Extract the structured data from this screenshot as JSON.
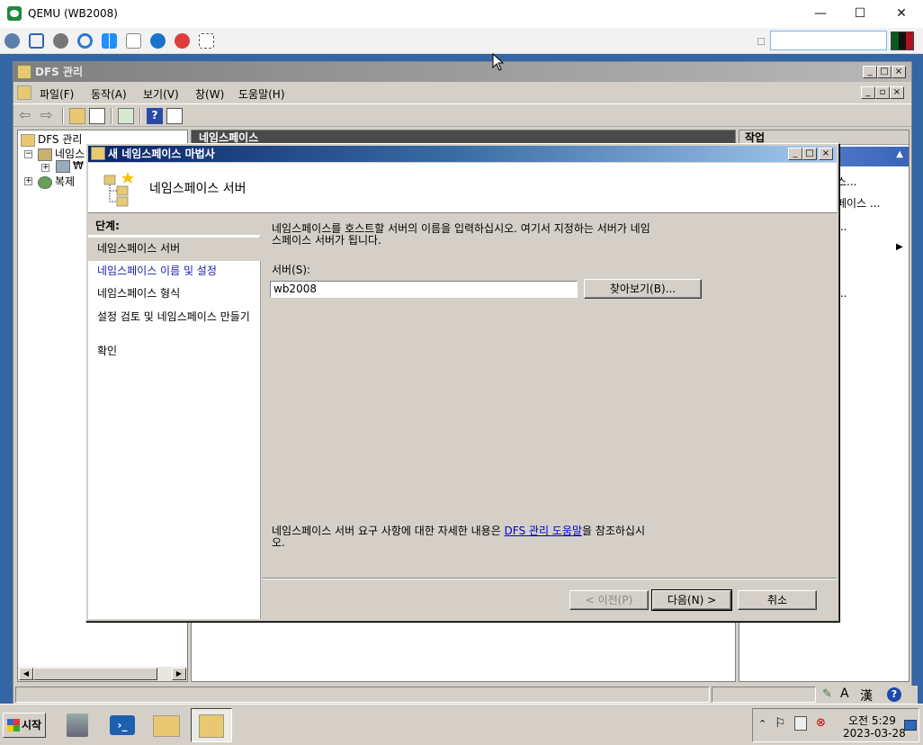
{
  "host": {
    "title": "QEMU (WB2008)",
    "minimize": "—",
    "maximize": "☐",
    "close": "✕"
  },
  "mmc": {
    "title": "DFS 관리",
    "menu": [
      "파일(F)",
      "동작(A)",
      "보기(V)",
      "창(W)",
      "도움말(H)"
    ],
    "tree": {
      "root": "DFS 관리",
      "namespaces": "네임스",
      "namespace_child": "₩",
      "replication": "복제"
    },
    "center_header": "네임스페이스",
    "actions": {
      "header": "작업",
      "items": [
        "스...",
        "페이스 ...",
        "...",
        "..."
      ]
    }
  },
  "wizard": {
    "title": "새 네임스페이스 마법사",
    "header_title": "네임스페이스 서버",
    "steps_label": "단계:",
    "steps": [
      "네임스페이스 서버",
      "네임스페이스 이름 및 설정",
      "네임스페이스 형식",
      "설정 검토 및 네임스페이스 만들기",
      "확인"
    ],
    "description_line1": "네임스페이스를 호스트할 서버의 이름을 입력하십시오. 여기서 지정하는 서버가 네임",
    "description_line2": "스페이스 서버가 됩니다.",
    "server_label": "서버(S):",
    "server_value": "wb2008",
    "browse_button": "찾아보기(B)...",
    "help_prefix": "네임스페이스 서버 요구 사항에 대한 자세한 내용은 ",
    "help_link": "DFS 관리 도움말",
    "help_suffix": "을 참조하십시",
    "help_line2": "오.",
    "back_button": "< 이전(P)",
    "next_button": "다음(N) >",
    "cancel_button": "취소"
  },
  "taskbar": {
    "start": "시작",
    "clock_time": "오전 5:29",
    "clock_date": "2023-03-28"
  },
  "colors": {
    "desktop": "#3465a4",
    "wizard_title": "#0a246a",
    "link": "#0000cc"
  }
}
